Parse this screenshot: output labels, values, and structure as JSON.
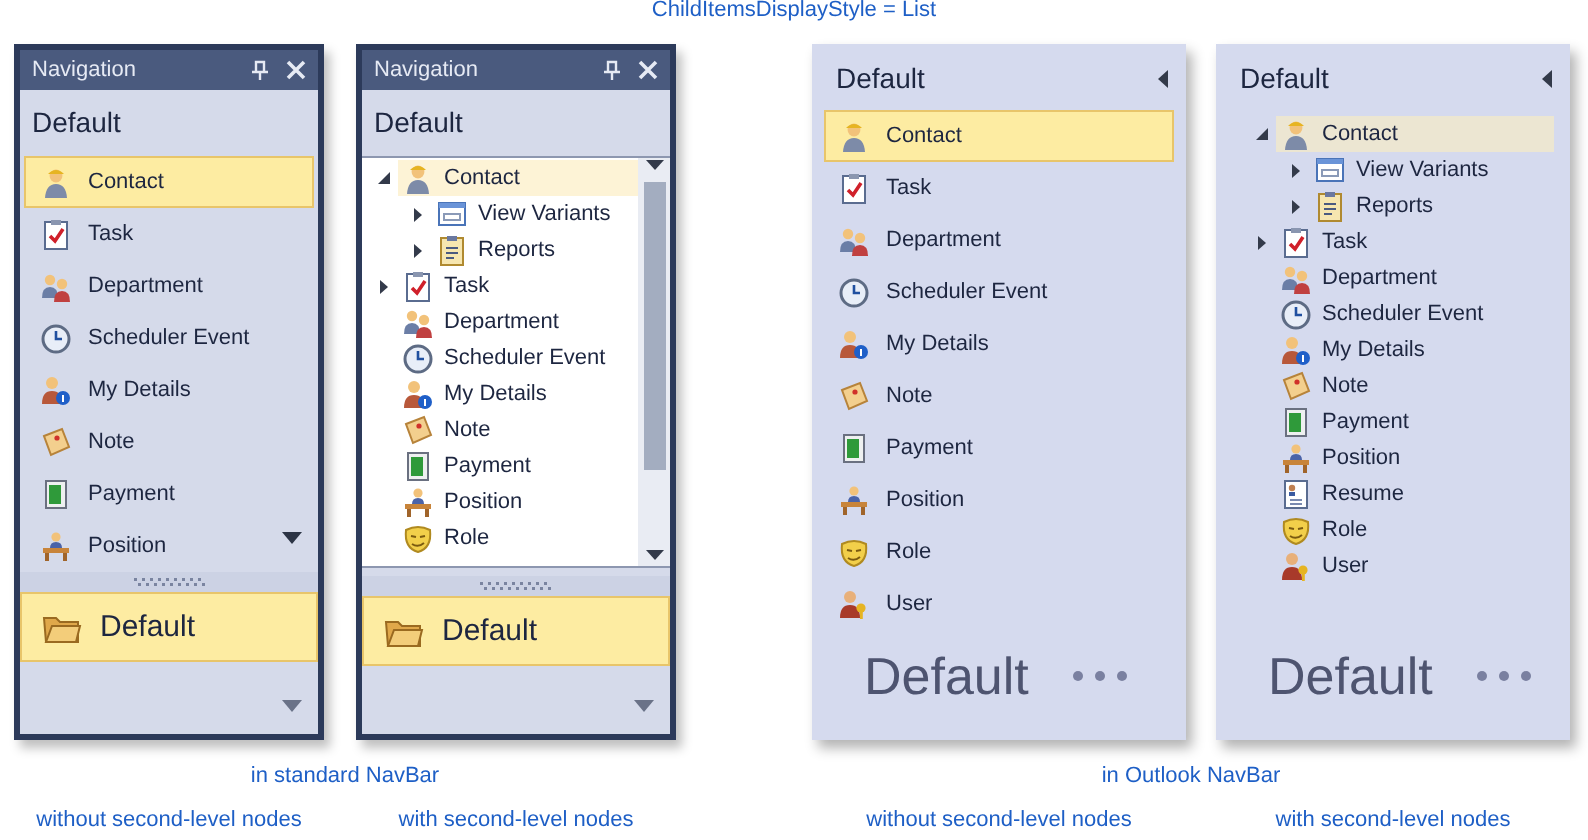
{
  "caption": "ChildItemsDisplayStyle = List",
  "panels": [
    {
      "kind": "standard-list",
      "title": "Navigation",
      "group": "Default",
      "group_button": "Default",
      "sublabel": "without second-level nodes",
      "items": [
        {
          "label": "Contact",
          "kind": "person",
          "selected": true
        },
        {
          "label": "Task",
          "kind": "task",
          "selected": false
        },
        {
          "label": "Department",
          "kind": "people",
          "selected": false
        },
        {
          "label": "Scheduler Event",
          "kind": "clock",
          "selected": false
        },
        {
          "label": "My Details",
          "kind": "person-info",
          "selected": false
        },
        {
          "label": "Note",
          "kind": "note",
          "selected": false
        },
        {
          "label": "Payment",
          "kind": "payment",
          "selected": false
        },
        {
          "label": "Position",
          "kind": "desk",
          "selected": false
        }
      ]
    },
    {
      "kind": "standard-tree",
      "title": "Navigation",
      "group": "Default",
      "group_button": "Default",
      "sublabel": "with second-level nodes",
      "items": [
        {
          "label": "Contact",
          "kind": "person",
          "selected": true,
          "expanded": true,
          "children": [
            {
              "label": "View Variants",
              "kind": "window",
              "selected": false,
              "expanded": false
            },
            {
              "label": "Reports",
              "kind": "report",
              "selected": false,
              "expanded": false
            }
          ]
        },
        {
          "label": "Task",
          "kind": "task",
          "selected": false,
          "expanded": false
        },
        {
          "label": "Department",
          "kind": "people",
          "selected": false
        },
        {
          "label": "Scheduler Event",
          "kind": "clock",
          "selected": false
        },
        {
          "label": "My Details",
          "kind": "person-info",
          "selected": false
        },
        {
          "label": "Note",
          "kind": "note",
          "selected": false
        },
        {
          "label": "Payment",
          "kind": "payment",
          "selected": false
        },
        {
          "label": "Position",
          "kind": "desk",
          "selected": false
        },
        {
          "label": "Role",
          "kind": "mask",
          "selected": false
        }
      ]
    },
    {
      "kind": "outlook-list",
      "group": "Default",
      "footer": "Default",
      "sublabel": "without second-level nodes",
      "items": [
        {
          "label": "Contact",
          "kind": "person",
          "selected": true
        },
        {
          "label": "Task",
          "kind": "task",
          "selected": false
        },
        {
          "label": "Department",
          "kind": "people",
          "selected": false
        },
        {
          "label": "Scheduler Event",
          "kind": "clock",
          "selected": false
        },
        {
          "label": "My Details",
          "kind": "person-info",
          "selected": false
        },
        {
          "label": "Note",
          "kind": "note",
          "selected": false
        },
        {
          "label": "Payment",
          "kind": "payment",
          "selected": false
        },
        {
          "label": "Position",
          "kind": "desk",
          "selected": false
        },
        {
          "label": "Role",
          "kind": "mask",
          "selected": false
        },
        {
          "label": "User",
          "kind": "user-key",
          "selected": false
        }
      ]
    },
    {
      "kind": "outlook-tree",
      "group": "Default",
      "footer": "Default",
      "sublabel": "with second-level nodes",
      "items": [
        {
          "label": "Contact",
          "kind": "person",
          "selected": true,
          "expanded": true,
          "children": [
            {
              "label": "View Variants",
              "kind": "window",
              "selected": false,
              "expanded": false
            },
            {
              "label": "Reports",
              "kind": "report",
              "selected": false,
              "expanded": false
            }
          ]
        },
        {
          "label": "Task",
          "kind": "task",
          "selected": false,
          "expanded": false
        },
        {
          "label": "Department",
          "kind": "people",
          "selected": false
        },
        {
          "label": "Scheduler Event",
          "kind": "clock",
          "selected": false
        },
        {
          "label": "My Details",
          "kind": "person-info",
          "selected": false
        },
        {
          "label": "Note",
          "kind": "note",
          "selected": false
        },
        {
          "label": "Payment",
          "kind": "payment",
          "selected": false
        },
        {
          "label": "Position",
          "kind": "desk",
          "selected": false
        },
        {
          "label": "Resume",
          "kind": "resume",
          "selected": false
        },
        {
          "label": "Role",
          "kind": "mask",
          "selected": false
        },
        {
          "label": "User",
          "kind": "user-key",
          "selected": false
        }
      ]
    }
  ],
  "group_labels": [
    "in standard NavBar",
    "in Outlook NavBar"
  ]
}
